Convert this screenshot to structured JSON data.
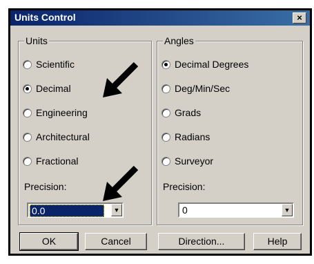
{
  "dialog": {
    "title": "Units Control",
    "close_glyph": "×"
  },
  "units": {
    "group_label": "Units",
    "options": [
      {
        "label": "Scientific",
        "selected": false
      },
      {
        "label": "Decimal",
        "selected": true
      },
      {
        "label": "Engineering",
        "selected": false
      },
      {
        "label": "Architectural",
        "selected": false
      },
      {
        "label": "Fractional",
        "selected": false
      }
    ],
    "precision_label": "Precision:",
    "precision_value": "0.0"
  },
  "angles": {
    "group_label": "Angles",
    "options": [
      {
        "label": "Decimal Degrees",
        "selected": true
      },
      {
        "label": "Deg/Min/Sec",
        "selected": false
      },
      {
        "label": "Grads",
        "selected": false
      },
      {
        "label": "Radians",
        "selected": false
      },
      {
        "label": "Surveyor",
        "selected": false
      }
    ],
    "precision_label": "Precision:",
    "precision_value": "0"
  },
  "buttons": {
    "ok": "OK",
    "cancel": "Cancel",
    "direction": "Direction...",
    "help": "Help"
  },
  "icons": {
    "dropdown": "chevron-down-icon",
    "annotation": "arrow-annotation-icon"
  }
}
